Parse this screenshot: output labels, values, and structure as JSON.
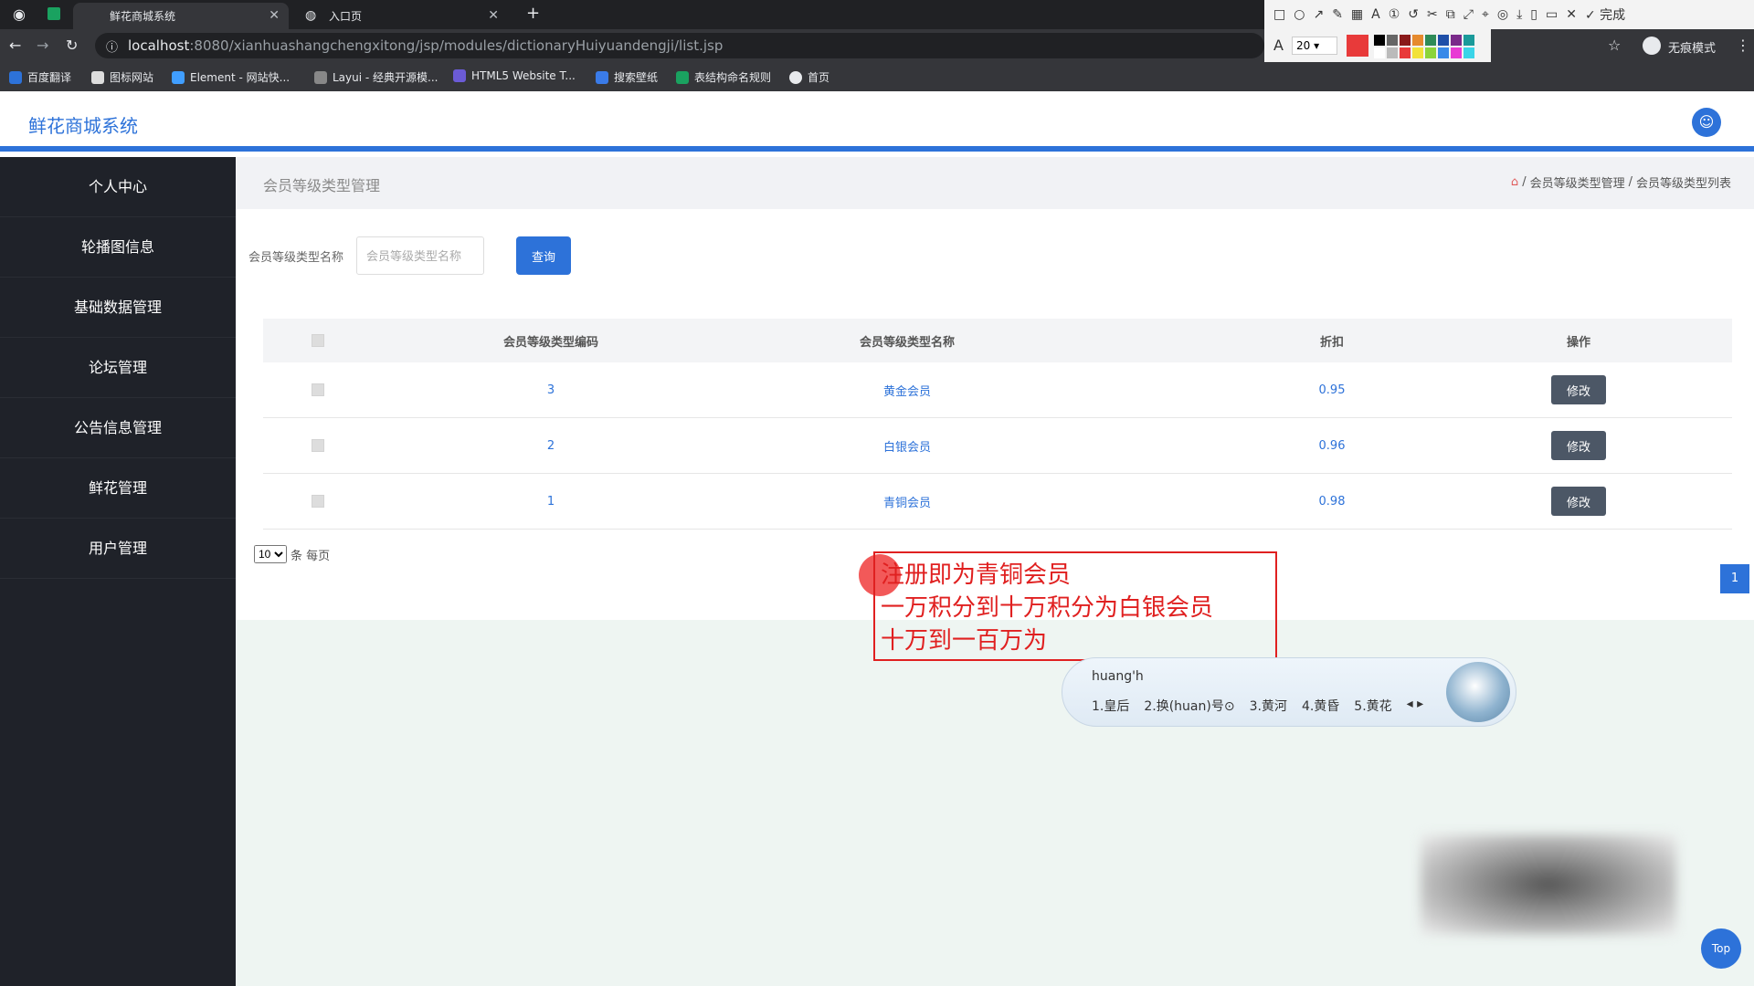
{
  "browser": {
    "tabs": [
      {
        "title": "鲜花商城系统",
        "active": true
      },
      {
        "title": "入口页",
        "active": false
      }
    ],
    "new_tab": "+",
    "url_host": "localhost",
    "url_path": ":8080/xianhuashangchengxitong/jsp/modules/dictionaryHuiyuandengji/list.jsp",
    "incognito_label": "无痕模式",
    "bookmarks": [
      "百度翻译",
      "图标网站",
      "Element - 网站快...",
      "Layui - 经典开源模...",
      "HTML5 Website T...",
      "搜索壁纸",
      "表结构命名规则",
      "首页"
    ]
  },
  "annotation_tool": {
    "font_size": "20",
    "done_label": "完成",
    "selected_color": "#e83a3a"
  },
  "app": {
    "title": "鲜花商城系统",
    "sidebar": [
      "个人中心",
      "轮播图信息",
      "基础数据管理",
      "论坛管理",
      "公告信息管理",
      "鲜花管理",
      "用户管理"
    ],
    "page_title": "会员等级类型管理",
    "breadcrumb": [
      "会员等级类型管理",
      "会员等级类型列表"
    ],
    "search": {
      "label": "会员等级类型名称",
      "placeholder": "会员等级类型名称",
      "button": "查询"
    },
    "table": {
      "headers": [
        "会员等级类型编码",
        "会员等级类型名称",
        "折扣",
        "操作"
      ],
      "rows": [
        {
          "code": "3",
          "name": "黄金会员",
          "discount": "0.95",
          "action": "修改"
        },
        {
          "code": "2",
          "name": "白银会员",
          "discount": "0.96",
          "action": "修改"
        },
        {
          "code": "1",
          "name": "青铜会员",
          "discount": "0.98",
          "action": "修改"
        }
      ]
    },
    "pager": {
      "page_size": "10",
      "suffix": "条 每页",
      "current_page": "1"
    },
    "top_button": "Top"
  },
  "annotation_note": {
    "lines": [
      "注册即为青铜会员",
      "一万积分到十万积分为白银会员",
      "十万到一百万为"
    ]
  },
  "ime": {
    "composition": "huang'h",
    "candidates": [
      "1.皇后",
      "2.换(huan)号⊙",
      "3.黄河",
      "4.黄昏",
      "5.黄花"
    ]
  }
}
